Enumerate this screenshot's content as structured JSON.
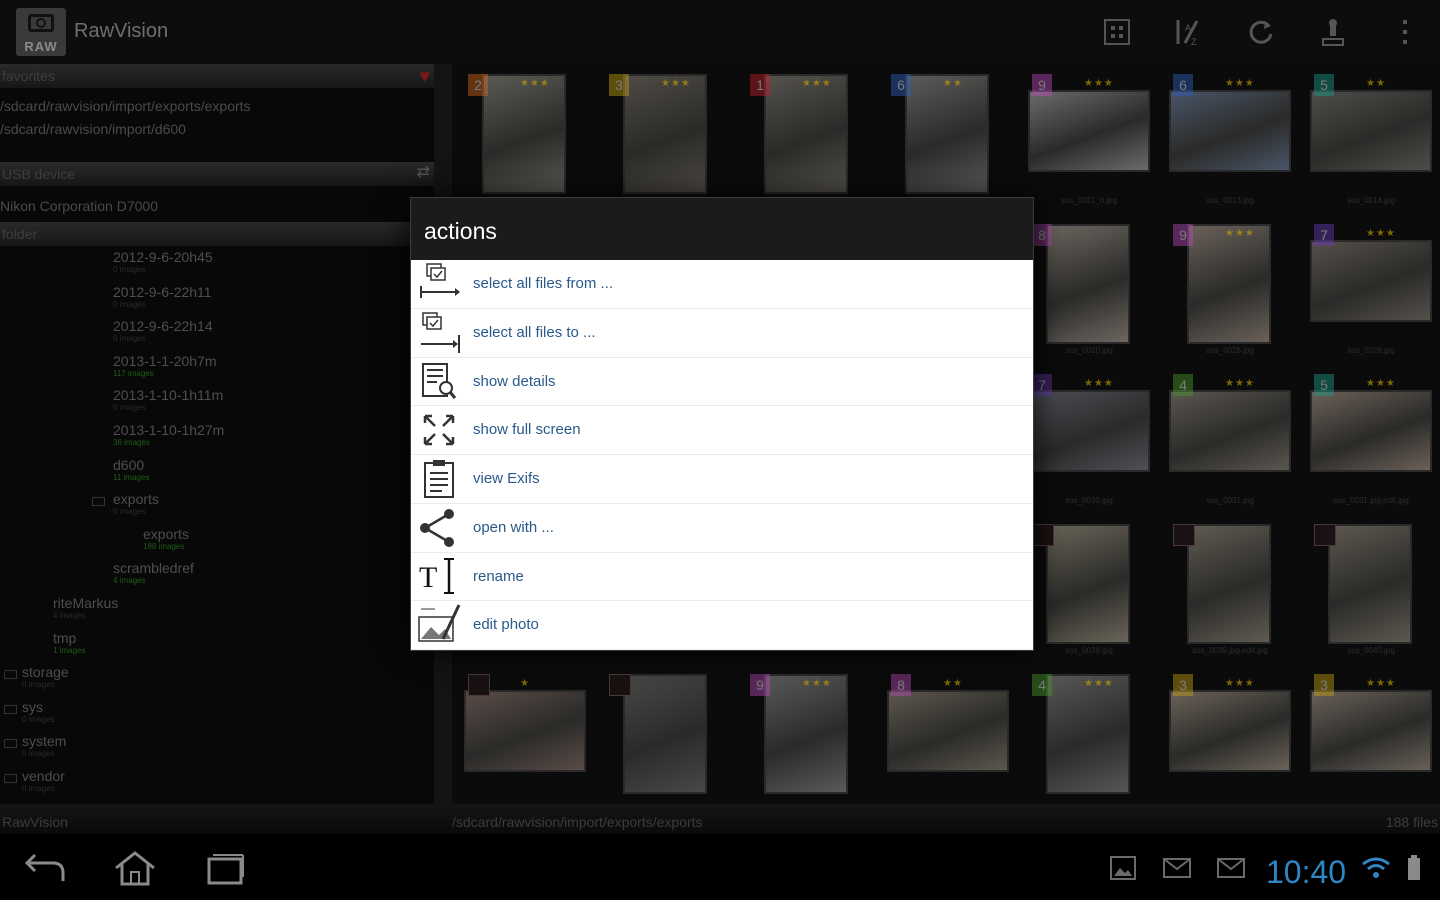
{
  "app": {
    "title": "RawVision",
    "logo_text": "RAW"
  },
  "actionbar_icons": [
    "grid-view-icon",
    "sort-icon",
    "refresh-icon",
    "import-icon",
    "overflow-menu-icon"
  ],
  "left_panel": {
    "favorites_header": "favorites",
    "favorites": [
      "/sdcard/rawvision/import/exports/exports",
      "/sdcard/rawvision/import/d600"
    ],
    "usb_header": "USB device",
    "usb_device": "Nikon Corporation D7000",
    "folder_header": "folder",
    "folders": [
      {
        "name": "2012-9-6-20h45",
        "count": "0 images",
        "green": false
      },
      {
        "name": "2012-9-6-22h11",
        "count": "0 images",
        "green": false
      },
      {
        "name": "2012-9-6-22h14",
        "count": "0 images",
        "green": false
      },
      {
        "name": "2013-1-1-20h7m",
        "count": "117 images",
        "green": true
      },
      {
        "name": "2013-1-10-1h11m",
        "count": "0 images",
        "green": false
      },
      {
        "name": "2013-1-10-1h27m",
        "count": "36 images",
        "green": true
      },
      {
        "name": "d600",
        "count": "11 images",
        "green": true
      },
      {
        "name": "exports",
        "count": "0 images",
        "green": false
      },
      {
        "name": "exports",
        "count": "188 images",
        "green": true
      },
      {
        "name": "scrambledref",
        "count": "4 images",
        "green": true
      },
      {
        "name": "riteMarkus",
        "count": "4 images",
        "green": false
      },
      {
        "name": "tmp",
        "count": "1 images",
        "green": true
      },
      {
        "name": "storage",
        "count": "0 images",
        "green": false
      },
      {
        "name": "sys",
        "count": "0 images",
        "green": false
      },
      {
        "name": "system",
        "count": "0 images",
        "green": false
      },
      {
        "name": "vendor",
        "count": "0 images",
        "green": false
      }
    ]
  },
  "grid": {
    "tiles": [
      {
        "num": "2",
        "color": "#d0641c",
        "stars": "★★★",
        "photo": "#5a5a55",
        "fname": ""
      },
      {
        "num": "3",
        "color": "#c2a012",
        "stars": "★★★",
        "photo": "#4f4b46",
        "fname": ""
      },
      {
        "num": "1",
        "color": "#c0202a",
        "stars": "★★★",
        "photo": "#55524e",
        "fname": ""
      },
      {
        "num": "6",
        "color": "#2d5fb8",
        "stars": "★★",
        "photo": "#5b5b5a",
        "fname": ""
      },
      {
        "num": "9",
        "color": "#b84ab8",
        "stars": "★★★",
        "photo": "#6b6b6b",
        "fname": "sos_0011_rl.jpg"
      },
      {
        "num": "6",
        "color": "#2d5fb8",
        "stars": "★★★",
        "photo": "#4a5568",
        "fname": "sos_0013.jpg"
      },
      {
        "num": "5",
        "color": "#1a9a8a",
        "stars": "★★",
        "photo": "#4d4d4a",
        "fname": "sos_0014.jpg"
      },
      {
        "num": "8",
        "color": "#b84ab8",
        "stars": "",
        "photo": "#6d6660",
        "fname": "sos_0020.jpg"
      },
      {
        "num": "9",
        "color": "#b84ab8",
        "stars": "★★★",
        "photo": "#6a615a",
        "fname": "sos_0026.jpg"
      },
      {
        "num": "7",
        "color": "#6a3ab8",
        "stars": "★★★",
        "photo": "#55504c",
        "fname": "sos_0028.jpg"
      },
      {
        "num": "7",
        "color": "#6a3ab8",
        "stars": "★★★",
        "photo": "#4e5058",
        "fname": "sos_0030.jpg"
      },
      {
        "num": "4",
        "color": "#4a9a2a",
        "stars": "★★★",
        "photo": "#5b5650",
        "fname": "sos_0031.jpg"
      },
      {
        "num": "5",
        "color": "#1a9a8a",
        "stars": "★★★",
        "photo": "#6b6058",
        "fname": "sos_0031.jpg.edit.jpg"
      },
      {
        "num": "",
        "color": "",
        "stars": "",
        "photo": "#6a6458",
        "fname": "sos_0039.jpg",
        "nophoto": true
      },
      {
        "num": "",
        "color": "",
        "stars": "",
        "photo": "#605a52",
        "fname": "sos_0039.jpg.edit.jpg",
        "nophoto": true
      },
      {
        "num": "",
        "color": "",
        "stars": "",
        "photo": "#5d5850",
        "fname": "sos_0040.jpg",
        "nophoto": true
      },
      {
        "num": "",
        "color": "",
        "stars": "★",
        "photo": "#5a4c48",
        "fname": "",
        "nophoto": true
      },
      {
        "num": "",
        "color": "",
        "stars": "",
        "photo": "#4a4846",
        "fname": "",
        "nophoto": true
      },
      {
        "num": "9",
        "color": "#b84ab8",
        "stars": "★★★",
        "photo": "#5a5a5a",
        "fname": ""
      },
      {
        "num": "8",
        "color": "#b84ab8",
        "stars": "★★",
        "photo": "#5d574e",
        "fname": ""
      },
      {
        "num": "4",
        "color": "#4a9a2a",
        "stars": "★★★",
        "photo": "#565656",
        "fname": ""
      },
      {
        "num": "3",
        "color": "#c2a012",
        "stars": "★★★",
        "photo": "#6a6258",
        "fname": ""
      },
      {
        "num": "3",
        "color": "#c2a012",
        "stars": "★★★",
        "photo": "#686058",
        "fname": ""
      }
    ]
  },
  "dialog": {
    "title": "actions",
    "items": [
      {
        "label": "select all files from ...",
        "icon": "select-from-icon"
      },
      {
        "label": "select all files to ...",
        "icon": "select-to-icon"
      },
      {
        "label": "show details",
        "icon": "details-icon"
      },
      {
        "label": "show full screen",
        "icon": "fullscreen-icon"
      },
      {
        "label": "view Exifs",
        "icon": "clipboard-icon"
      },
      {
        "label": "open with ...",
        "icon": "share-icon"
      },
      {
        "label": "rename",
        "icon": "rename-icon"
      },
      {
        "label": "edit photo",
        "icon": "edit-photo-icon"
      }
    ]
  },
  "status": {
    "left": "RawVision",
    "path": "/sdcard/rawvision/import/exports/exports",
    "count": "188 files"
  },
  "system": {
    "clock": "10:40",
    "clock_color": "#2f86c6"
  }
}
